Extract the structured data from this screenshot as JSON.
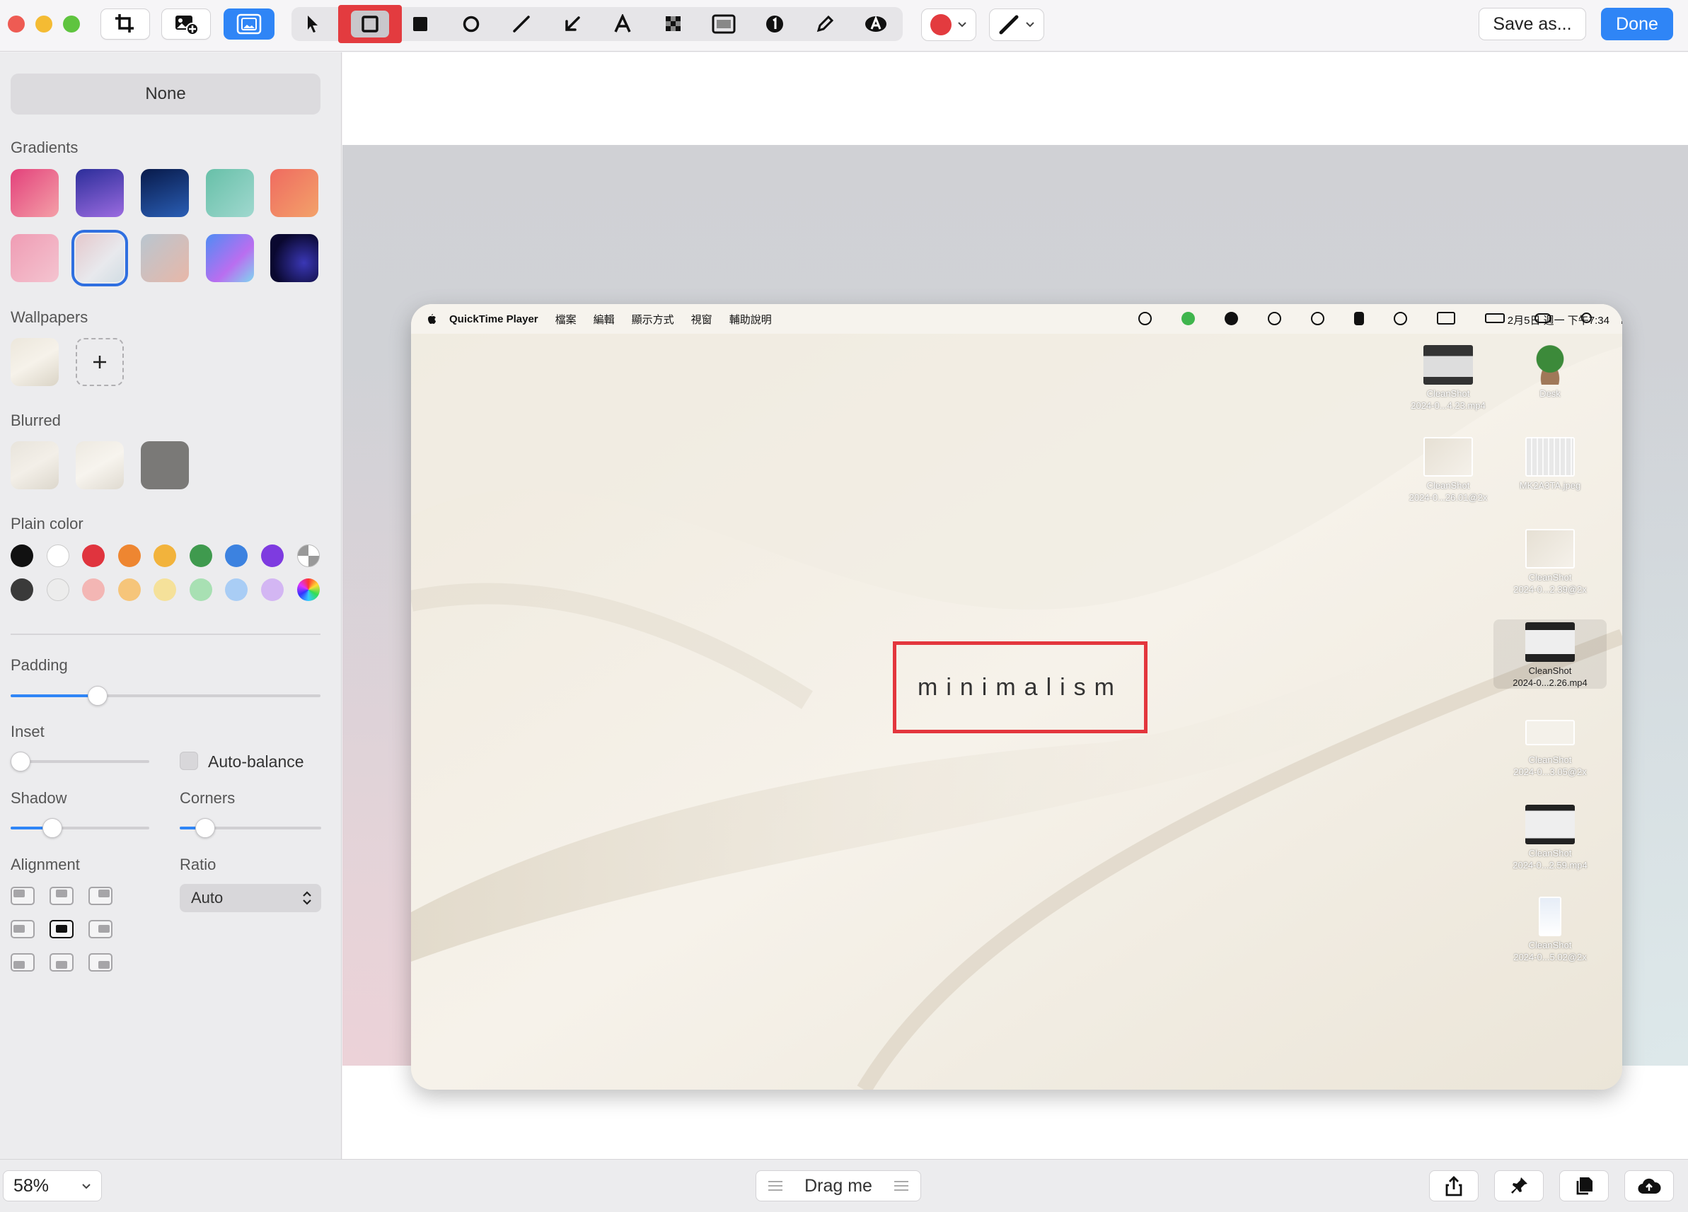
{
  "toolbar": {
    "save_label": "Save as...",
    "done_label": "Done",
    "accent_color": "#2f85f6",
    "annotation_color": "#e33b3f",
    "tools": [
      "pointer-icon",
      "rectangle-outline-icon",
      "rectangle-filled-icon",
      "ellipse-icon",
      "line-icon",
      "arrow-icon",
      "text-icon",
      "pixelate-icon",
      "spotlight-icon",
      "counter-icon",
      "pencil-icon",
      "highlighter-icon"
    ],
    "selected_tool": "rectangle-outline-icon"
  },
  "sidebar": {
    "none_label": "None",
    "gradients_label": "Gradients",
    "wallpapers_label": "Wallpapers",
    "blurred_label": "Blurred",
    "plain_color_label": "Plain color",
    "padding_label": "Padding",
    "inset_label": "Inset",
    "auto_balance_label": "Auto-balance",
    "shadow_label": "Shadow",
    "corners_label": "Corners",
    "alignment_label": "Alignment",
    "ratio_label": "Ratio",
    "ratio_value": "Auto",
    "padding_value": 0.28,
    "inset_value": 0.0,
    "shadow_value": 0.3,
    "corners_value": 0.18,
    "selected_gradient_index": 6,
    "selected_alignment_index": 4,
    "plain_colors_row1": [
      "#111111",
      "#ffffff",
      "#e0343e",
      "#ee8631",
      "#f2b33c",
      "#3f9a4e",
      "#3c82e0",
      "#7e3be0"
    ],
    "plain_colors_row2": [
      "#3a3a3a",
      "#ececec",
      "#f3b6b4",
      "#f6c57a",
      "#f5e19a",
      "#a8e0b3",
      "#a9cdf5",
      "#d3b6f3"
    ]
  },
  "canvas": {
    "menubar": {
      "app_name": "QuickTime Player",
      "menus": [
        "檔案",
        "編輯",
        "顯示方式",
        "視窗",
        "輔助說明"
      ],
      "clock": "2月5日 週一 下午7:34"
    },
    "desktop_icons": [
      {
        "name": "CleanShot",
        "sub": "2024-0...4.23.mp4"
      },
      {
        "name": "Desk",
        "sub": ""
      },
      {
        "name": "CleanShot",
        "sub": "2024-0...26.01@2x"
      },
      {
        "name": "MK2A3TA.jpeg",
        "sub": ""
      },
      {
        "name": "CleanShot",
        "sub": "2024-0...2.39@2x"
      },
      {
        "name": "CleanShot",
        "sub": "2024-0...2.26.mp4"
      },
      {
        "name": "CleanShot",
        "sub": "2024-0...3.05@2x"
      },
      {
        "name": "CleanShot",
        "sub": "2024-0...2.59.mp4"
      },
      {
        "name": "CleanShot",
        "sub": "2024-0...5.02@2x"
      }
    ],
    "wallpaper_text": "minimalism"
  },
  "bottombar": {
    "zoom": "58%",
    "drag_label": "Drag me"
  }
}
